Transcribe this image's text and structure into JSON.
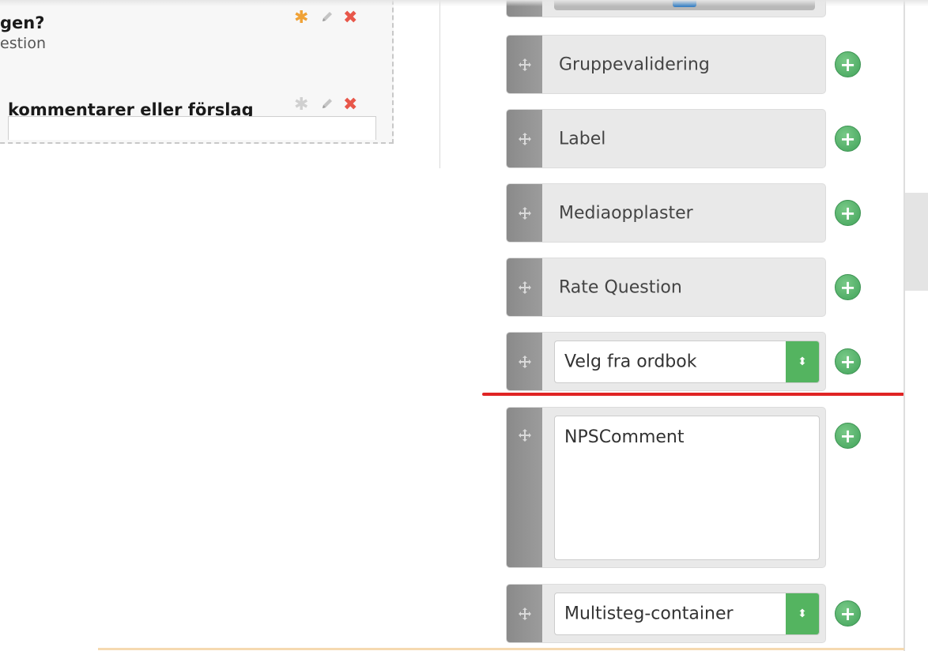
{
  "form": {
    "question1_title": "gen?",
    "question1_subtitle": "estion",
    "question2_title": "kommentarer eller förslag"
  },
  "icons": {
    "star": "star-icon",
    "pencil": "pencil-icon",
    "delete": "x-icon",
    "move": "move-icon",
    "add": "plus-circle-icon",
    "select_arrows": "updown-arrow-icon"
  },
  "toolbox": {
    "items": [
      {
        "type": "button",
        "label": "Gruppevalidering"
      },
      {
        "type": "button",
        "label": "Label"
      },
      {
        "type": "button",
        "label": "Mediaopplaster"
      },
      {
        "type": "button",
        "label": "Rate Question"
      },
      {
        "type": "select",
        "value": "Velg fra ordbok"
      },
      {
        "type": "textarea",
        "value": "NPSComment"
      },
      {
        "type": "select",
        "value": "Multisteg-container"
      }
    ]
  },
  "colors": {
    "accent_green": "#54b460",
    "star_active": "#f0a236",
    "delete_red": "#e8574a",
    "drop_indicator": "#e02424"
  }
}
